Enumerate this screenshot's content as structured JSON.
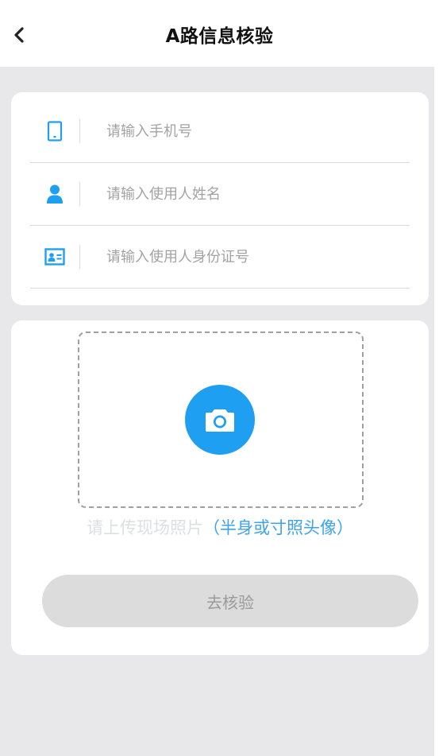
{
  "header": {
    "title": "A路信息核验",
    "back_icon": "chevron-left-icon"
  },
  "form": {
    "phone": {
      "placeholder": "请输入手机号",
      "icon": "phone-icon",
      "value": ""
    },
    "name": {
      "placeholder": "请输入使用人姓名",
      "icon": "person-icon",
      "value": ""
    },
    "id_card": {
      "placeholder": "请输入使用人身份证号",
      "icon": "id-card-icon",
      "value": ""
    }
  },
  "upload": {
    "icon": "camera-icon",
    "hint_main": "请上传现场照片",
    "hint_note": "（半身或寸照头像）"
  },
  "submit": {
    "label": "去核验",
    "state": "disabled"
  },
  "colors": {
    "accent": "#1e9ff2",
    "hint_note": "#3ca3ec",
    "button_bg": "#dcdcdc",
    "page_bg": "#e8e7ea"
  }
}
